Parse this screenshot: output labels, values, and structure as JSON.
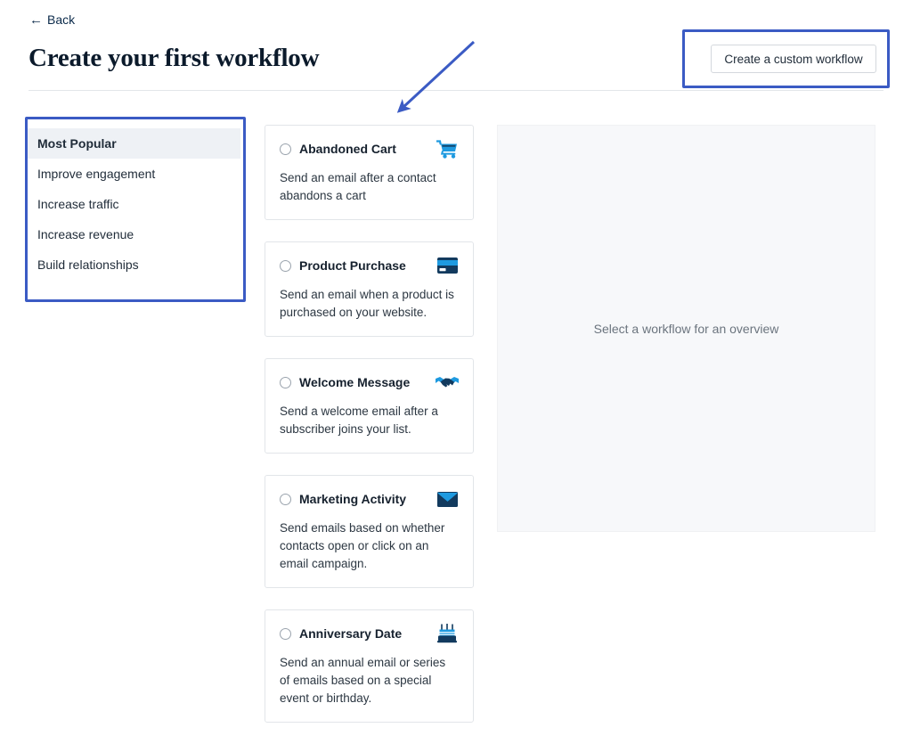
{
  "header": {
    "back_label": "Back",
    "back_icon": "arrow-left-icon",
    "title": "Create your first workflow",
    "custom_workflow_button": "Create a custom workflow"
  },
  "sidebar": {
    "items": [
      {
        "label": "Most Popular",
        "active": true
      },
      {
        "label": "Improve engagement",
        "active": false
      },
      {
        "label": "Increase traffic",
        "active": false
      },
      {
        "label": "Increase revenue",
        "active": false
      },
      {
        "label": "Build relationships",
        "active": false
      }
    ]
  },
  "cards": [
    {
      "title": "Abandoned Cart",
      "description": "Send an email after a contact abandons a cart",
      "icon": "shopping-cart-icon",
      "selected": false
    },
    {
      "title": "Product Purchase",
      "description": "Send an email when a product is purchased on your website.",
      "icon": "credit-card-icon",
      "selected": false
    },
    {
      "title": "Welcome Message",
      "description": "Send a welcome email after a subscriber joins your list.",
      "icon": "handshake-icon",
      "selected": false
    },
    {
      "title": "Marketing Activity",
      "description": "Send emails based on whether contacts open or click on an email campaign.",
      "icon": "envelope-icon",
      "selected": false
    },
    {
      "title": "Anniversary Date",
      "description": "Send an annual email or series of emails based on a special event or birthday.",
      "icon": "birthday-cake-icon",
      "selected": false
    }
  ],
  "overview": {
    "placeholder_text": "Select a workflow for an overview"
  },
  "annotations": {
    "highlight_color": "#3b5bc4",
    "arrow_color": "#3b5bc4",
    "button_highlight_target": "Create a custom workflow",
    "sidebar_highlight_target": "Most Popular"
  },
  "colors": {
    "icon_blue_light": "#1e9ae0",
    "icon_blue_dark": "#123a5e",
    "active_row_bg": "#eef1f5",
    "panel_bg": "#f7f8fa",
    "card_border": "#e2e5e9"
  }
}
